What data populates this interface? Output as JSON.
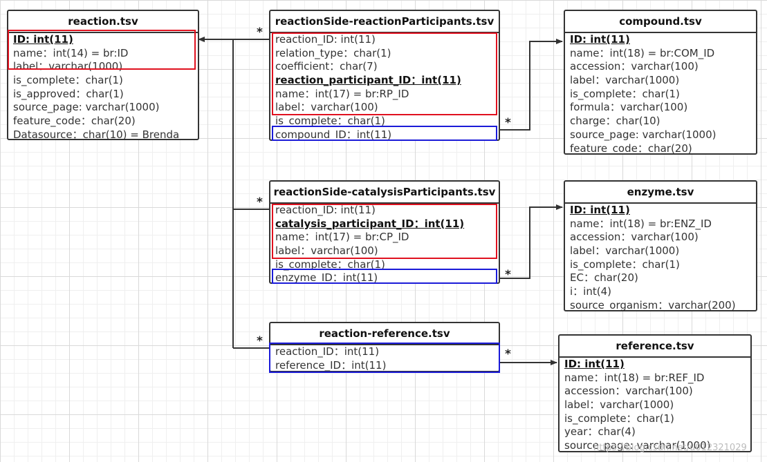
{
  "tables": {
    "reaction": {
      "title": "reaction.tsv",
      "fields": [
        "ID: int(11)",
        "name：int(14) = br:ID",
        "label：varchar(1000)",
        "is_complete：char(1)",
        "is_approved：char(1)",
        "source_page: varchar(1000)",
        "feature_code：char(20)",
        "Datasource：char(10) = Brenda"
      ]
    },
    "reaction_participants": {
      "title": "reactionSide-reactionParticipants.tsv",
      "fields": [
        "reaction_ID: int(11)",
        "relation_type：char(1)",
        "coefficient：char(7)",
        "reaction_participant_ID：int(11)",
        "name：int(17) = br:RP_ID",
        "label：varchar(100)",
        "is_complete：char(1)",
        "compound_ID：int(11)"
      ]
    },
    "compound": {
      "title": "compound.tsv",
      "fields": [
        "ID: int(11)",
        "name：int(18) = br:COM_ID",
        "accession：varchar(100)",
        "label：varchar(1000)",
        "is_complete：char(1)",
        "formula：varchar(100)",
        "charge：char(10)",
        "source_page: varchar(1000)",
        "feature_code：char(20)"
      ]
    },
    "catalysis_participants": {
      "title": "reactionSide-catalysisParticipants.tsv",
      "fields": [
        "reaction_ID: int(11)",
        "catalysis_participant_ID：int(11)",
        "name：int(17) = br:CP_ID",
        "label：varchar(100)",
        "is_complete：char(1)",
        "enzyme_ID：int(11)"
      ]
    },
    "enzyme": {
      "title": "enzyme.tsv",
      "fields": [
        "ID: int(11)",
        "name：int(18) = br:ENZ_ID",
        "accession：varchar(100)",
        "label：varchar(1000)",
        "is_complete：char(1)",
        "EC：char(20)",
        "i：int(4)",
        "source_organism：varchar(200)"
      ]
    },
    "reaction_reference": {
      "title": "reaction-reference.tsv",
      "fields": [
        "reaction_ID：int(11)",
        "reference_ID：int(11)"
      ]
    },
    "reference": {
      "title": "reference.tsv",
      "fields": [
        "ID: int(11)",
        "name：int(18) = br:REF_ID",
        "accession：varchar(100)",
        "label：varchar(1000)",
        "is_complete：char(1)",
        "year：char(4)",
        "source_page: varchar(1000)"
      ]
    }
  },
  "relations": {
    "many_symbol": "*"
  },
  "colors": {
    "primary_key_box": "#e0101e",
    "foreign_key_box": "#1a1ad8",
    "line": "#333333"
  },
  "watermark": "https://blog.csdn.net/u012321029"
}
